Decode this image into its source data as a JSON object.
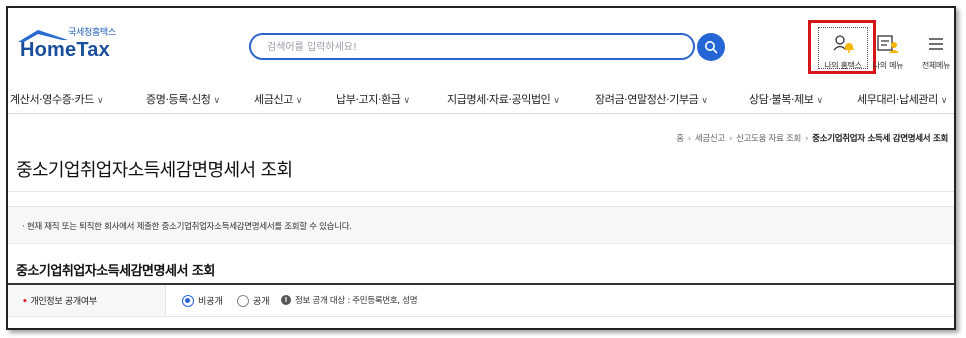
{
  "logo": {
    "small_text": "국세청홈택스",
    "main_text": "HomeTax"
  },
  "search": {
    "placeholder": "검색어를 입력하세요!",
    "button_icon": "search-icon"
  },
  "header_utils": [
    {
      "label": "나의 홈택스",
      "icon": "user-bell-icon",
      "highlighted": true,
      "highlight_color": "#d4161b"
    },
    {
      "label": "나의 메뉴",
      "icon": "my-menu-icon"
    },
    {
      "label": "전체메뉴",
      "icon": "hamburger-icon"
    }
  ],
  "nav": {
    "items": [
      {
        "label": "계산서·영수증·카드"
      },
      {
        "label": "증명·등록·신청"
      },
      {
        "label": "세금신고"
      },
      {
        "label": "납부·고지·환급"
      },
      {
        "label": "지급명세·자료·공익법인"
      },
      {
        "label": "장려금·연말정산·기부금"
      },
      {
        "label": "상담·불복·제보"
      },
      {
        "label": "세무대리·납세관리"
      }
    ]
  },
  "breadcrumb": {
    "items": [
      "홈",
      "세금신고",
      "신고도움 자료 조회"
    ],
    "current": "중소기업취업자 소득세 감면명세서 조회"
  },
  "page": {
    "title": "중소기업취업자소득세감면명세서 조회",
    "notice": "현재 재직 또는 퇴직한 회사에서 제출한 중소기업취업자소득세감면명세서를 조회할 수 있습니다.",
    "section_title": "중소기업취업자소득세감면명세서 조회"
  },
  "form": {
    "privacy_label": "개인정보 공개여부",
    "options": [
      {
        "label": "비공개",
        "selected": true
      },
      {
        "label": "공개",
        "selected": false
      }
    ],
    "info_text": "정보 공개 대상 : 주민등록번호, 성명"
  },
  "colors": {
    "brand_blue": "#1b4f9c",
    "accent_blue": "#2566d6",
    "required_red": "#e0232b"
  }
}
